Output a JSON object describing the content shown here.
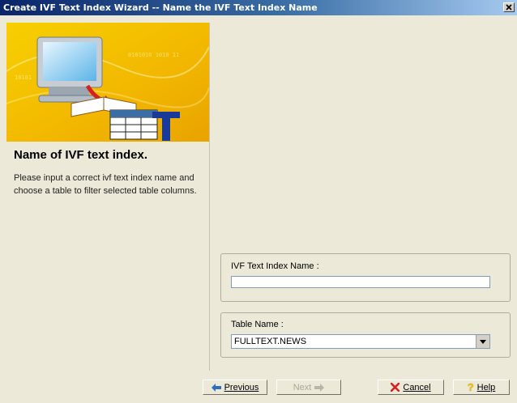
{
  "window": {
    "title": "Create IVF Text Index Wizard -- Name the IVF Text Index Name",
    "close_glyph": "×"
  },
  "left_panel": {
    "heading": "Name of IVF text index.",
    "description": "Please input a correct ivf text index name and choose a table to filter selected table columns."
  },
  "form": {
    "index_name_label": "IVF Text Index Name :",
    "index_name_value": "",
    "table_name_label": "Table Name :",
    "table_name_value": "FULLTEXT.NEWS"
  },
  "buttons": {
    "previous": "Previous",
    "next": "Next",
    "cancel": "Cancel",
    "help": "Help"
  },
  "icons": {
    "previous": "arrow-left-icon",
    "next": "arrow-right-icon",
    "cancel": "red-x-icon",
    "help": "question-icon",
    "dropdown": "chevron-down-icon"
  },
  "colors": {
    "title_bar_start": "#0a246a",
    "title_bar_end": "#a6caf0",
    "banner_yellow": "#f5c400",
    "cancel_red": "#d62020",
    "help_yellow": "#f2c200",
    "arrow_blue": "#2c6ec5"
  }
}
